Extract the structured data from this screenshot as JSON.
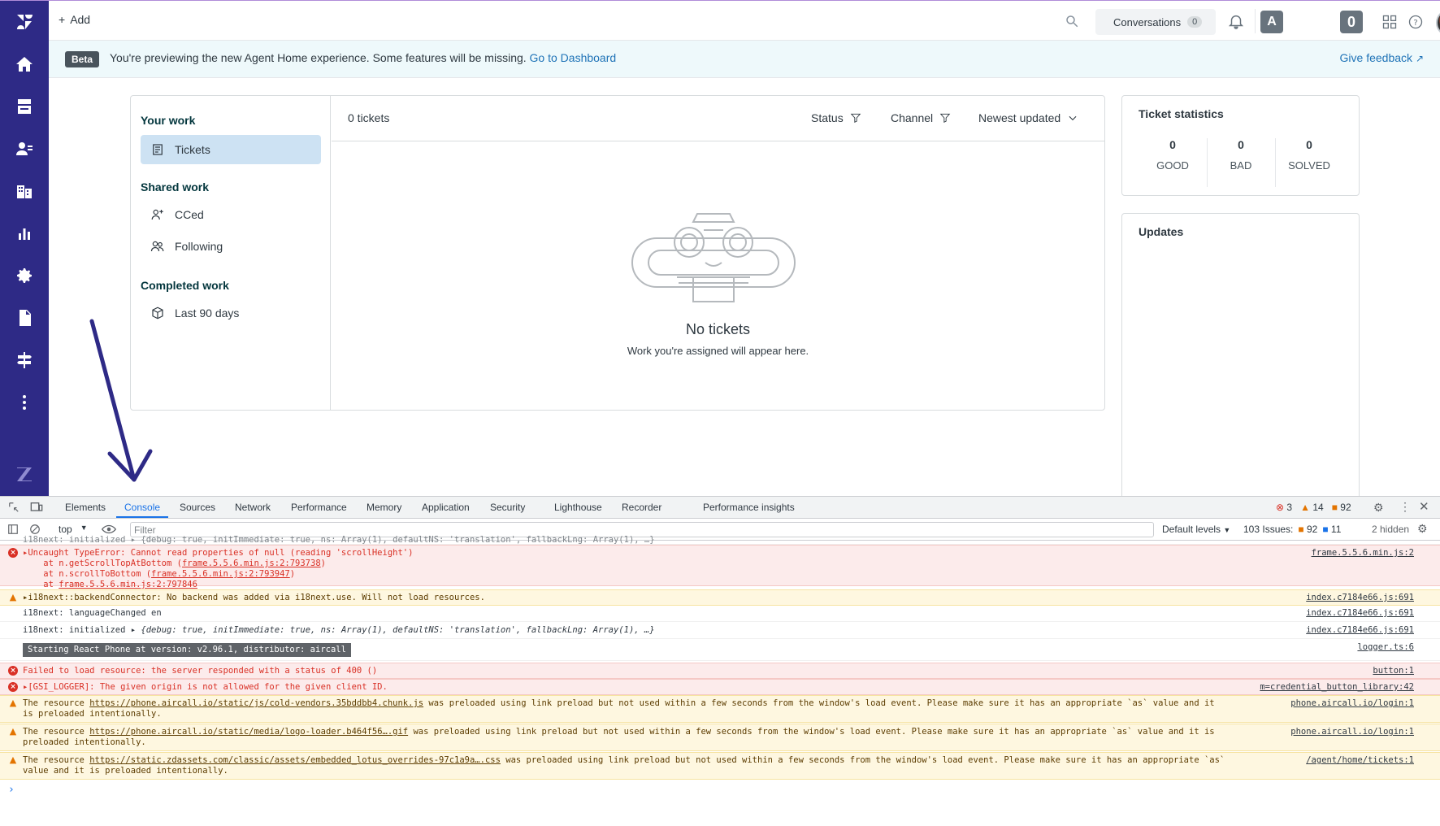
{
  "topbar": {
    "add_label": "Add",
    "conversations_label": "Conversations",
    "conversations_count": "0",
    "badge_a": "A",
    "badge_zero": "0"
  },
  "banner": {
    "beta": "Beta",
    "message": "You're previewing the new Agent Home experience. Some features will be missing.",
    "link": "Go to Dashboard",
    "feedback": "Give feedback"
  },
  "views": {
    "your_work": "Your work",
    "tickets": "Tickets",
    "shared_work": "Shared work",
    "cced": "CCed",
    "following": "Following",
    "completed_work": "Completed work",
    "last90": "Last 90 days"
  },
  "list": {
    "count": "0 tickets",
    "status": "Status",
    "channel": "Channel",
    "sort": "Newest updated",
    "empty_title": "No tickets",
    "empty_sub": "Work you're assigned will appear here."
  },
  "stats": {
    "title": "Ticket statistics",
    "good_n": "0",
    "good": "GOOD",
    "bad_n": "0",
    "bad": "BAD",
    "solved_n": "0",
    "solved": "SOLVED"
  },
  "updates": {
    "title": "Updates"
  },
  "devtools": {
    "tabs": [
      "Elements",
      "Console",
      "Sources",
      "Network",
      "Performance",
      "Memory",
      "Application",
      "Security",
      "Lighthouse",
      "Recorder",
      "Performance insights"
    ],
    "errors": "3",
    "warnings": "14",
    "issues_count": "92",
    "context": "top",
    "filter_placeholder": "Filter",
    "levels": "Default levels",
    "issues_label": "103 Issues:",
    "issues_a": "92",
    "issues_b": "11",
    "hidden": "2 hidden"
  },
  "console": {
    "top_cut": "i18next: initialized ▸ {debug: true, initImmediate: true, ns: Array(1), defaultNS: 'translation', fallbackLng: Array(1), …}",
    "e1": "▸Uncaught TypeError: Cannot read properties of null (reading 'scrollHeight')",
    "e1_a": "    at n.getScrollTopAtBottom (",
    "e1_a_link": "frame.5.5.6.min.js:2:793738",
    "e1_b": "    at n.scrollToBottom (",
    "e1_b_link": "frame.5.5.6.min.js:2:793947",
    "e1_c": "    at ",
    "e1_c_link": "frame.5.5.6.min.js:2:797846",
    "e1_src": "frame.5.5.6.min.js:2",
    "w1": "▸i18next::backendConnector: No backend was added via i18next.use. Will not load resources.",
    "w1_src": "index.c7184e66.js:691",
    "i1": "i18next: languageChanged en",
    "i1_src": "index.c7184e66.js:691",
    "i2": "i18next: initialized ",
    "i2_obj": "▸ {debug: true, initImmediate: true, ns: Array(1), defaultNS: 'translation', fallbackLng: Array(1), …}",
    "i2_src": "index.c7184e66.js:691",
    "react": "Starting React Phone at version: v2.96.1, distributor: aircall",
    "react_src": "logger.ts:6",
    "e2": "Failed to load resource: the server responded with a status of 400 ()",
    "e2_src": "button:1",
    "e3": "▸[GSI_LOGGER]: The given origin is not allowed for the given client ID.",
    "e3_src": "m=credential_button_library:42",
    "w2_pre": "The resource ",
    "w2_link": "https://phone.aircall.io/static/js/cold-vendors.35bddbb4.chunk.js",
    "w2_post": " was preloaded using link preload but not used within a few seconds from the window's load event. Please make sure it has an appropriate `as` value and it",
    "w2_cont": "is preloaded intentionally.",
    "w2_src": "phone.aircall.io/login:1",
    "w3_pre": "The resource ",
    "w3_link": "https://phone.aircall.io/static/media/logo-loader.b464f56….gif",
    "w3_post": " was preloaded using link preload but not used within a few seconds from the window's load event. Please make sure it has an appropriate `as` value and it is",
    "w3_cont": "preloaded intentionally.",
    "w3_src": "phone.aircall.io/login:1",
    "w4_pre": "The resource ",
    "w4_link": "https://static.zdassets.com/classic/assets/embedded_lotus_overrides-97c1a9a….css",
    "w4_post": " was preloaded using link preload but not used within a few seconds from the window's load event. Please make sure it has an appropriate `as`",
    "w4_cont": "value and it is preloaded intentionally.",
    "w4_src": "/agent/home/tickets:1",
    "prompt": "›"
  }
}
